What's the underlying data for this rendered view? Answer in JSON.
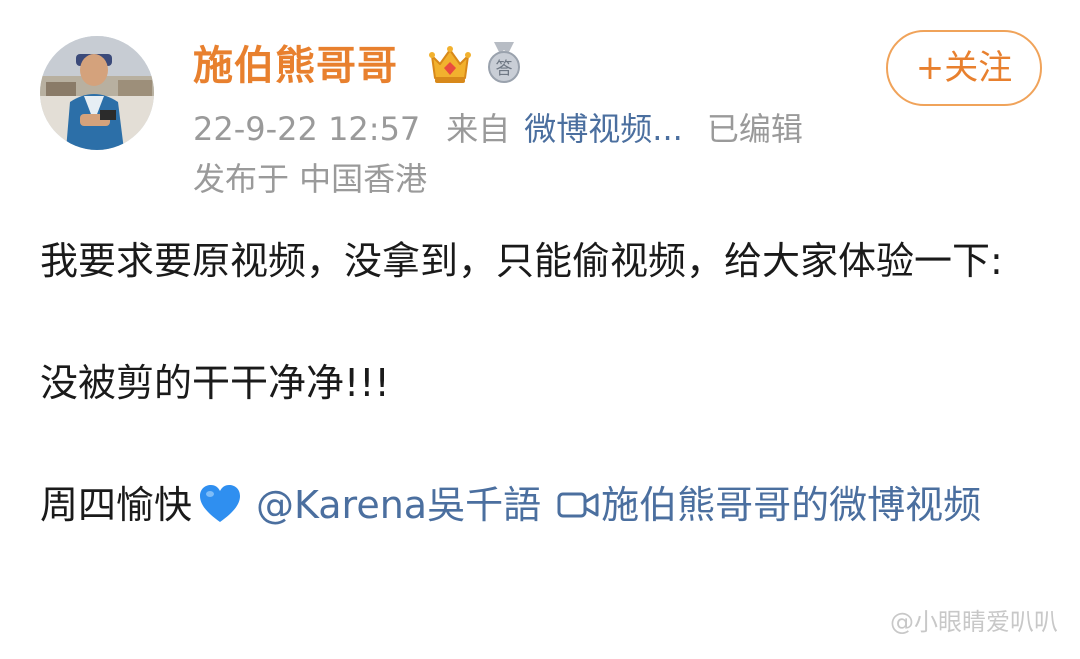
{
  "user": {
    "name": "施伯熊哥哥",
    "medal_text": "答"
  },
  "actions": {
    "follow_label": "+关注"
  },
  "meta": {
    "time": "22-9-22 12:57",
    "from_label": "来自",
    "source": "微博视频...",
    "edited": "已编辑",
    "location": "发布于 中国香港"
  },
  "post": {
    "line1": "我要求要原视频，没拿到，只能偷视频，给大家体验一下:",
    "line2": "没被剪的干干净净!!!",
    "line3_text": "周四愉快",
    "mention": "@Karena吳千語",
    "video_link": "施伯熊哥哥的微博视频"
  },
  "watermark": "小眼睛爱叭叭",
  "colors": {
    "username": "#e8802e",
    "link": "#4b6f9f",
    "meta": "#9a9a9a"
  },
  "icons": [
    "avatar-photo",
    "crown-badge-icon",
    "medal-badge-icon",
    "blue-heart-icon",
    "video-icon"
  ]
}
